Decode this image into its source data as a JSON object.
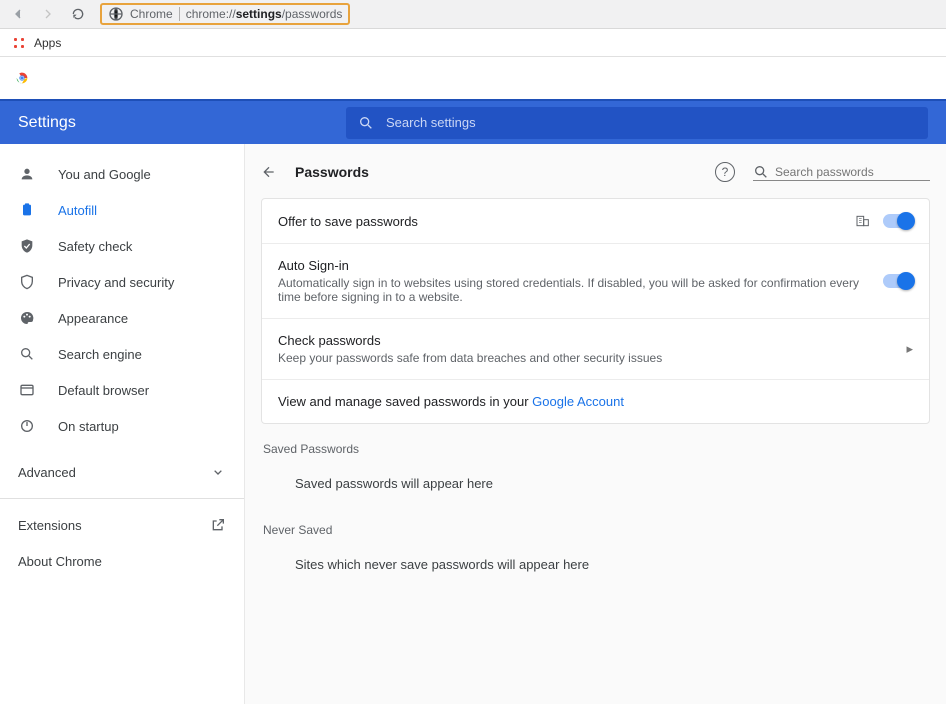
{
  "nav": {
    "apps_label": "Apps",
    "omnibox": {
      "scheme_label": "Chrome",
      "url_pre": "chrome://",
      "url_bold": "settings",
      "url_post": "/passwords"
    }
  },
  "header": {
    "title": "Settings",
    "search_placeholder": "Search settings"
  },
  "sidebar": {
    "items": [
      {
        "label": "You and Google"
      },
      {
        "label": "Autofill"
      },
      {
        "label": "Safety check"
      },
      {
        "label": "Privacy and security"
      },
      {
        "label": "Appearance"
      },
      {
        "label": "Search engine"
      },
      {
        "label": "Default browser"
      },
      {
        "label": "On startup"
      }
    ],
    "advanced": "Advanced",
    "extensions": "Extensions",
    "about": "About Chrome"
  },
  "page": {
    "title": "Passwords",
    "search_placeholder": "Search passwords",
    "rows": {
      "offer": {
        "title": "Offer to save passwords"
      },
      "autosign": {
        "title": "Auto Sign-in",
        "sub": "Automatically sign in to websites using stored credentials. If disabled, you will be asked for confirmation every time before signing in to a website."
      },
      "check": {
        "title": "Check passwords",
        "sub": "Keep your passwords safe from data breaches and other security issues"
      },
      "view_text": "View and manage saved passwords in your ",
      "view_link": "Google Account"
    },
    "saved_label": "Saved Passwords",
    "saved_placeholder": "Saved passwords will appear here",
    "never_label": "Never Saved",
    "never_placeholder": "Sites which never save passwords will appear here"
  }
}
